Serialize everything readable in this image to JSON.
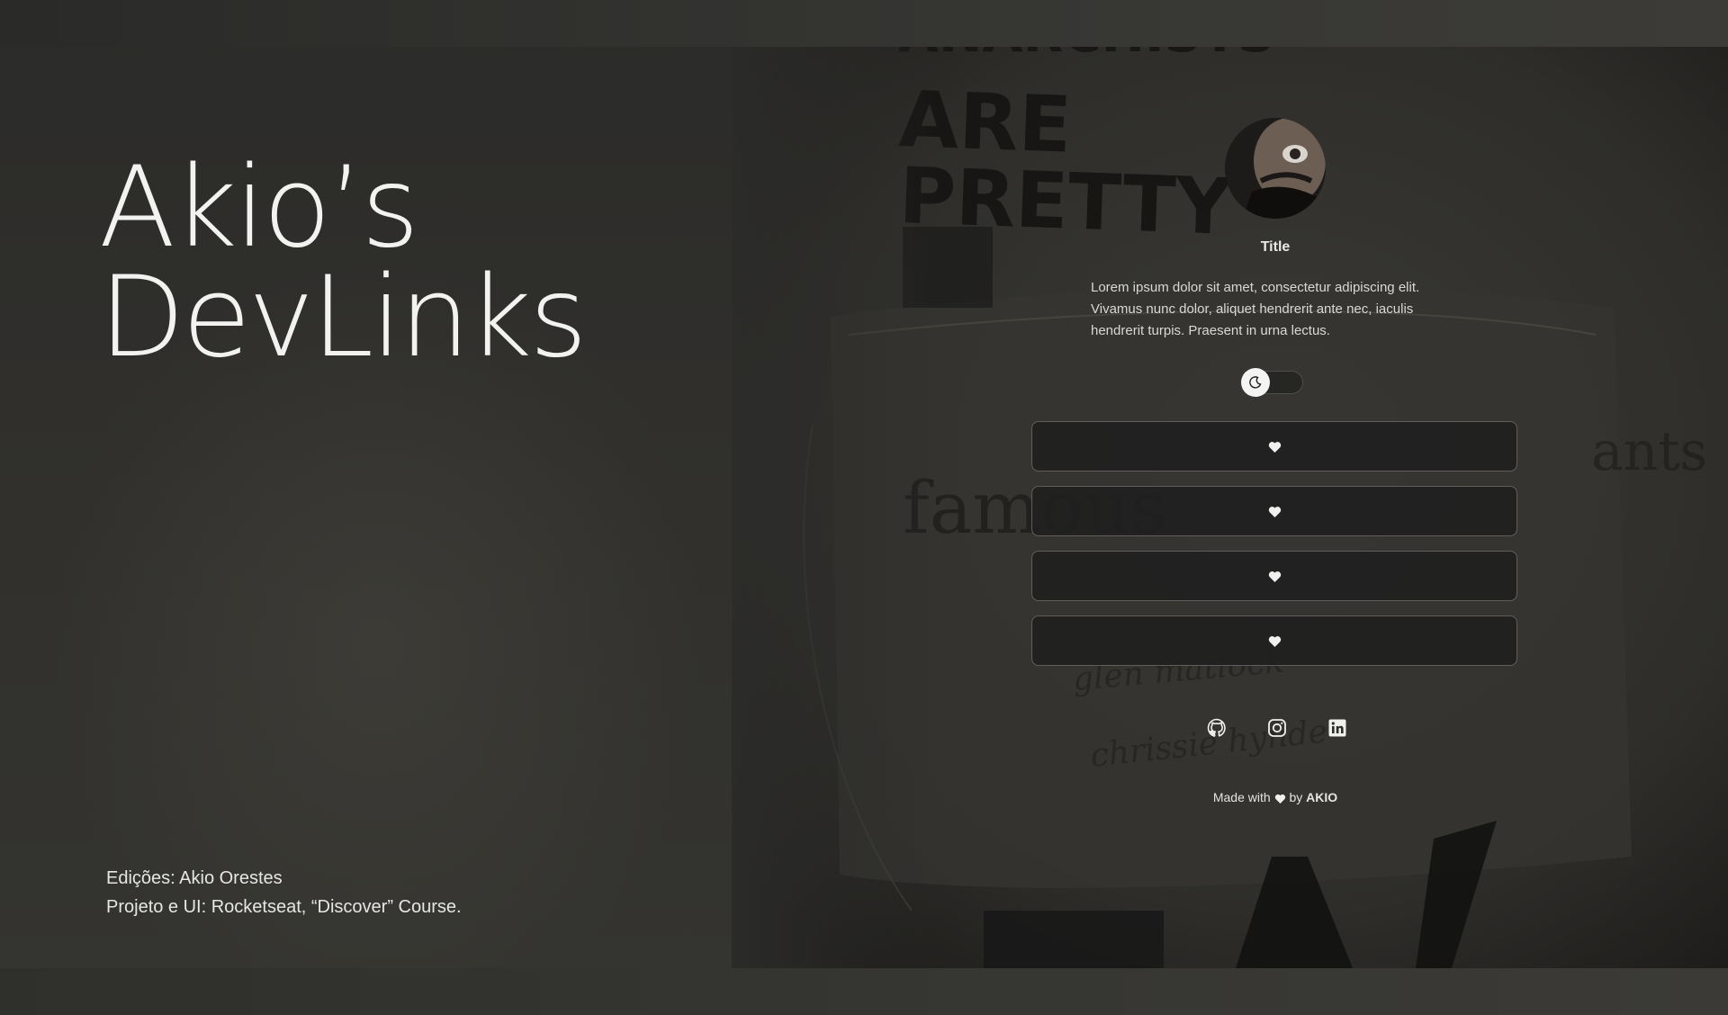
{
  "hero": {
    "title_line1": "Akio’s",
    "title_line2": "DevLinks"
  },
  "credits": {
    "line1": "Edições: Akio Orestes",
    "line2": "Projeto e UI: Rocketseat, “Discover” Course."
  },
  "profile": {
    "title": "Title",
    "bio": "Lorem ipsum dolor sit amet, consectetur adipiscing elit. Vivamus nunc dolor, aliquet hendrerit ante nec, iaculis hendrerit turpis. Praesent in urna lectus."
  },
  "toggle": {
    "icon": "moon-icon",
    "state": "off"
  },
  "links": [
    {
      "icon": "heart-icon"
    },
    {
      "icon": "heart-icon"
    },
    {
      "icon": "heart-icon"
    },
    {
      "icon": "heart-icon"
    }
  ],
  "socials": [
    "github-icon",
    "instagram-icon",
    "linkedin-icon"
  ],
  "footer": {
    "prefix": "Made with",
    "by": "by",
    "author": "AKIO"
  },
  "background_text": {
    "headline1": "ARE",
    "headline2": "PRETTY",
    "script_word": "famous",
    "script_word2": "ants",
    "name1": "glen matlock",
    "name2": "chrissie hynde"
  },
  "colors": {
    "background": "#2c2c2a",
    "text": "#f2f2f0",
    "button_bg": "#20201f"
  }
}
